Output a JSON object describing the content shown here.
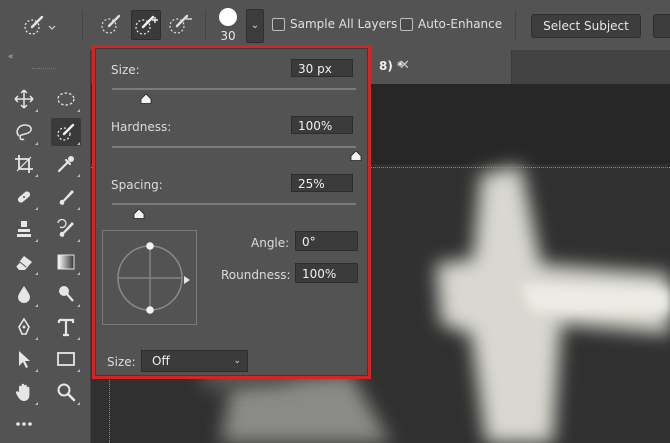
{
  "options_bar": {
    "brush_size_value": "30",
    "brush_dropdown_glyph": "⌄",
    "sample_all_layers_label": "Sample All Layers",
    "sample_all_layers_checked": false,
    "auto_enhance_label": "Auto-Enhance",
    "auto_enhance_checked": false,
    "select_subject_label": "Select Subject"
  },
  "toolbar": {
    "collapse_glyph": "«",
    "tools": [
      "move-icon",
      "elliptical-marquee-icon",
      "lasso-icon",
      "quick-selection-icon",
      "crop-icon",
      "eyedropper-icon",
      "spot-healing-icon",
      "brush-icon",
      "clone-stamp-icon",
      "history-brush-icon",
      "eraser-icon",
      "gradient-icon",
      "blur-icon",
      "dodge-icon",
      "pen-icon",
      "type-icon",
      "path-selection-icon",
      "rectangle-icon",
      "hand-icon",
      "zoom-icon",
      "more-icon"
    ],
    "active_tool": "quick-selection-icon"
  },
  "document": {
    "tab_title": "8)",
    "tab_modified": "*",
    "tab_close_glyph": "✕"
  },
  "brush_popover": {
    "size_label": "Size:",
    "size_value": "30 px",
    "size_level": 0.14,
    "hardness_label": "Hardness:",
    "hardness_value": "100%",
    "hardness_level": 1.0,
    "spacing_label": "Spacing:",
    "spacing_value": "25%",
    "spacing_level": 0.11,
    "angle_label": "Angle:",
    "angle_value": "0°",
    "roundness_label": "Roundness:",
    "roundness_value": "100%",
    "pen_size_label": "Size:",
    "pen_size_value": "Off",
    "chevron_glyph": "⌄"
  },
  "colors": {
    "highlight_border": "#d42424",
    "panel_bg": "#535353",
    "field_bg": "#3b3b3b"
  }
}
